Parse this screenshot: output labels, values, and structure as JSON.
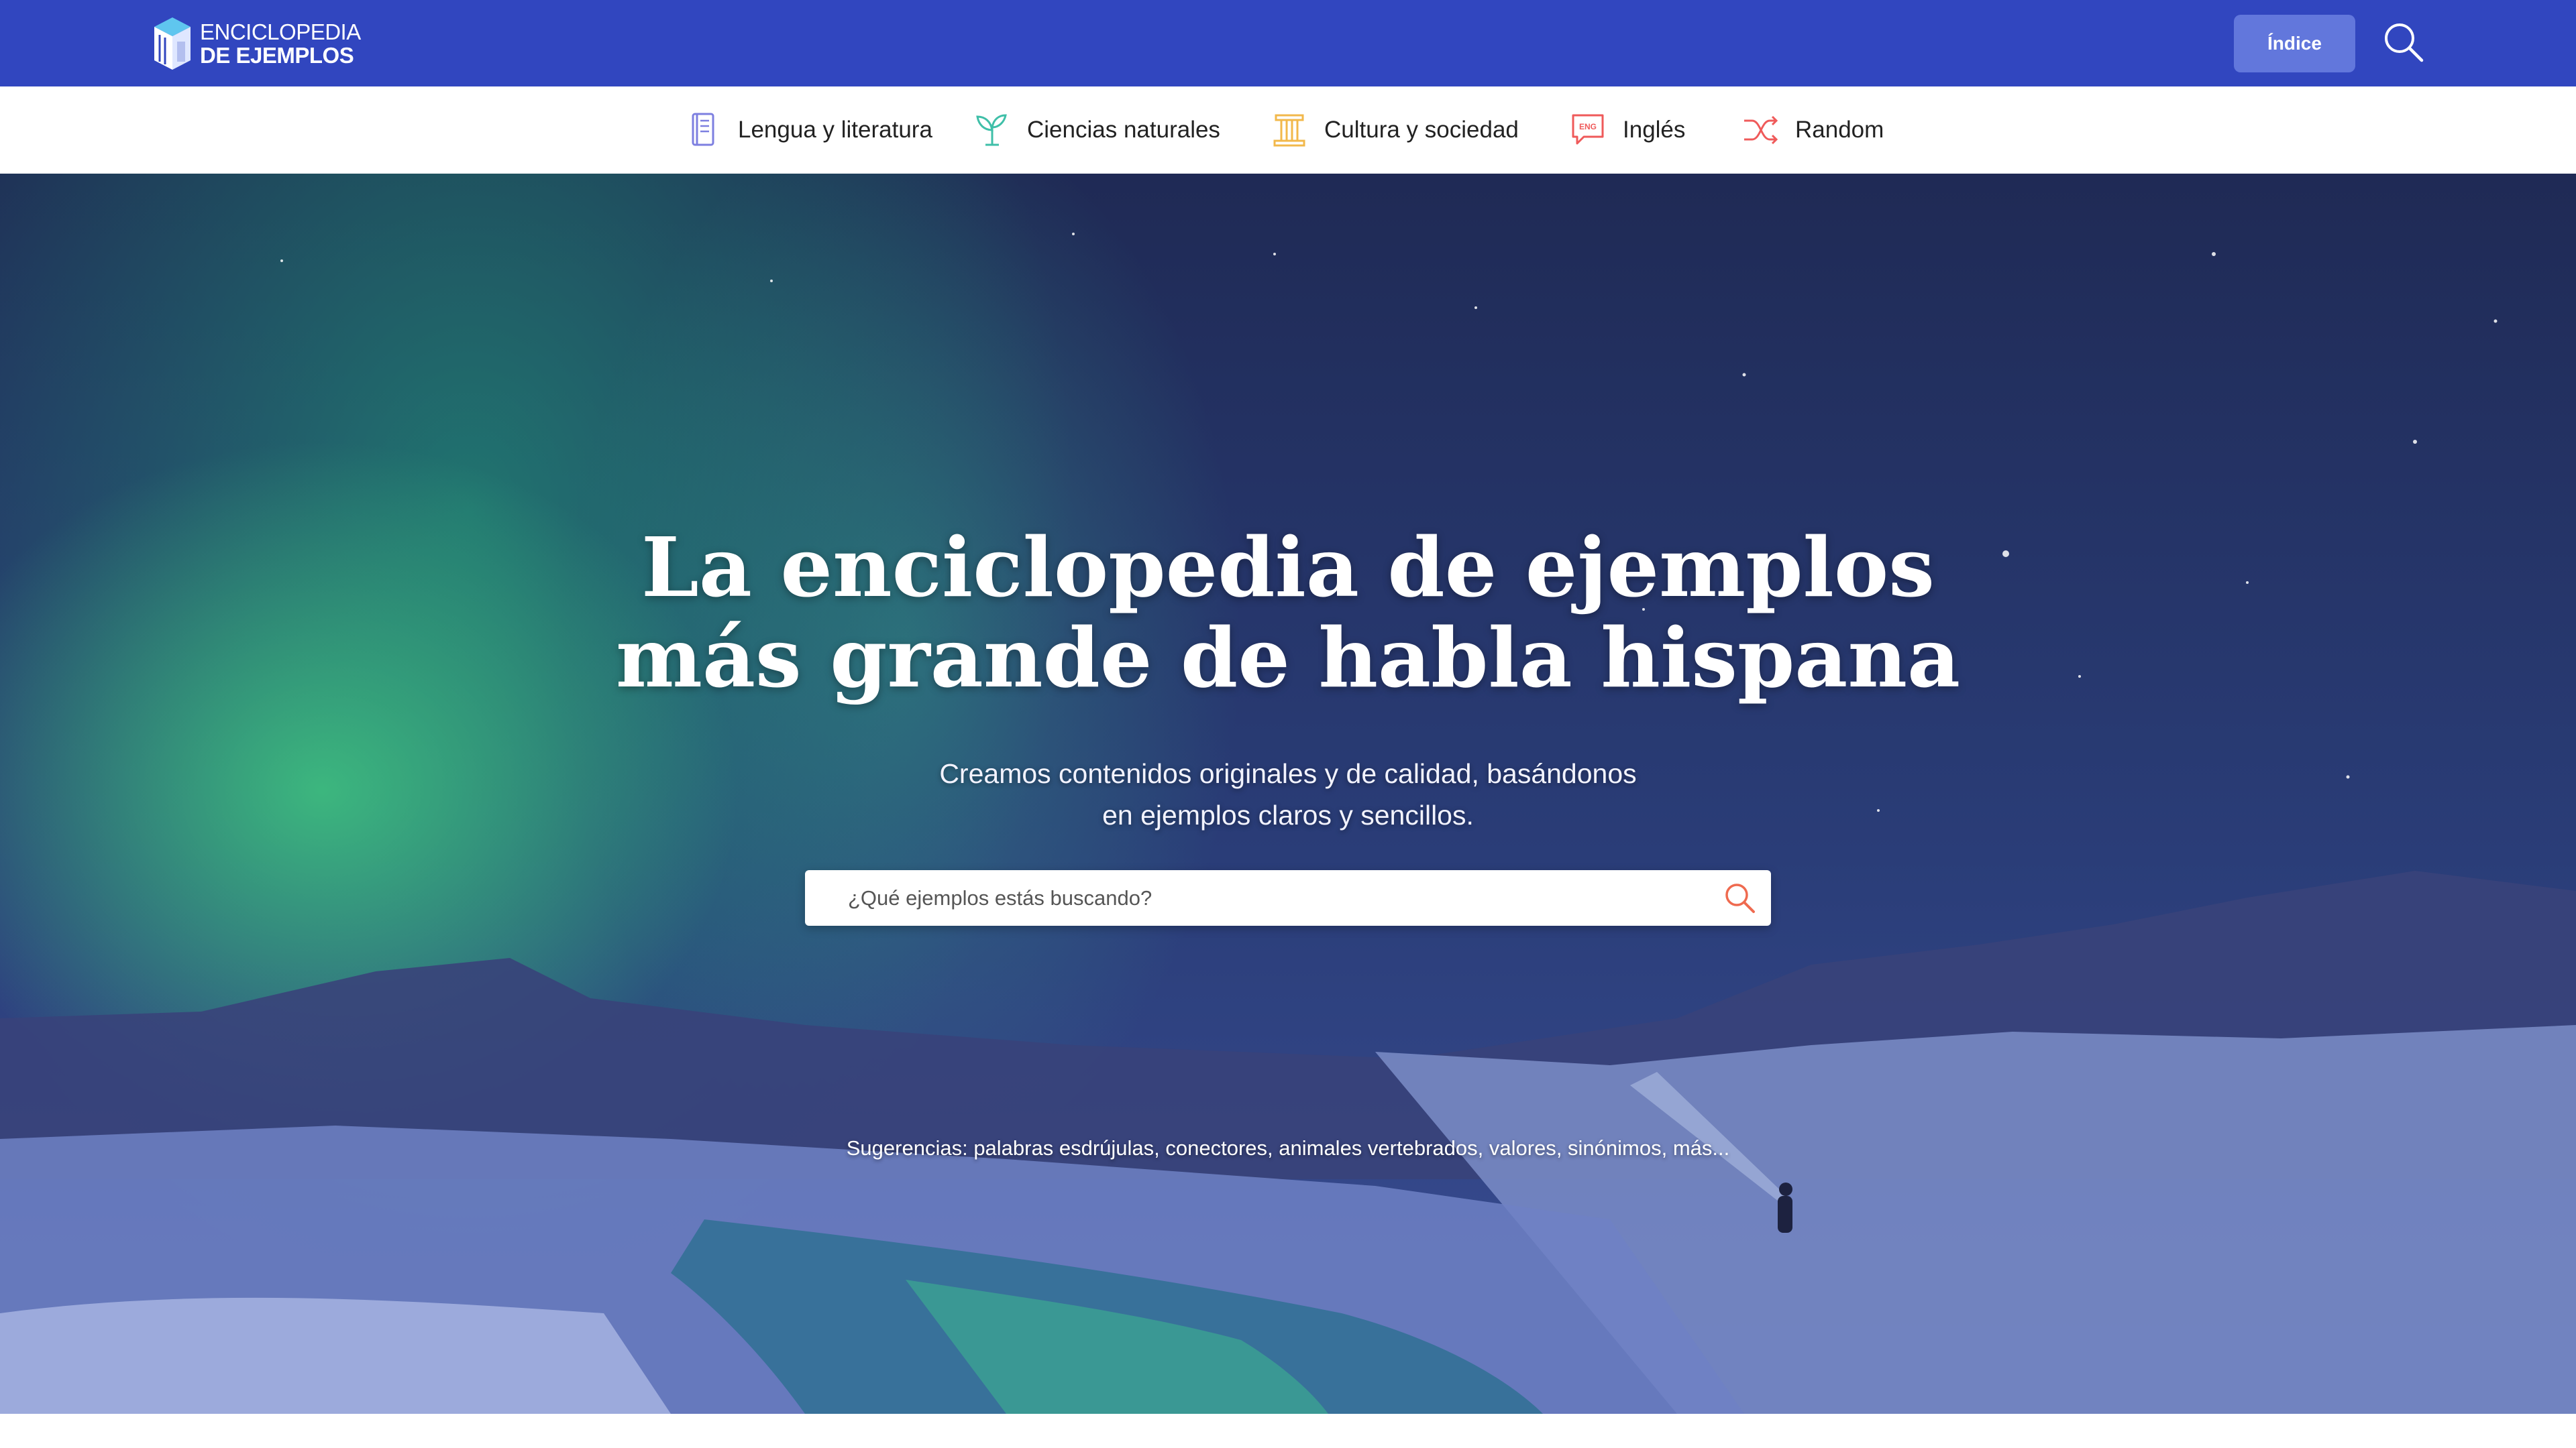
{
  "header": {
    "logo_line1": "ENCICLOPEDIA",
    "logo_line2": "DE EJEMPLOS",
    "index_button": "Índice",
    "search_icon": "search-icon",
    "background_color": "#3146bf",
    "button_color": "#6277dc"
  },
  "nav": {
    "items": [
      {
        "label": "Lengua y literatura",
        "icon": "book-icon",
        "color": "#7d7fe0"
      },
      {
        "label": "Ciencias naturales",
        "icon": "plant-icon",
        "color": "#3fbfa8"
      },
      {
        "label": "Cultura y sociedad",
        "icon": "column-icon",
        "color": "#f2b84b"
      },
      {
        "label": "Inglés",
        "icon": "eng-chat-icon",
        "color": "#ef5a5a"
      },
      {
        "label": "Random",
        "icon": "shuffle-icon",
        "color": "#ef5a5a"
      }
    ]
  },
  "hero": {
    "title_line1": "La enciclopedia de ejemplos",
    "title_line2": "más grande de habla hispana",
    "subtitle_line1": "Creamos contenidos originales y de calidad, basándonos",
    "subtitle_line2": "en ejemplos claros y sencillos.",
    "search_placeholder": "¿Qué ejemplos estás buscando?",
    "search_icon": "search-icon",
    "suggestions_prefix": "Sugerencias:",
    "suggestions": [
      {
        "label": "palabras esdrújulas",
        "sep": ", "
      },
      {
        "label": "conectores",
        "sep": ", "
      },
      {
        "label": "animales vertebrados",
        "sep": ", "
      },
      {
        "label": "valores",
        "sep": ", "
      },
      {
        "label": "sinónimos",
        "sep": ", "
      },
      {
        "label": "más...",
        "sep": ""
      }
    ]
  }
}
